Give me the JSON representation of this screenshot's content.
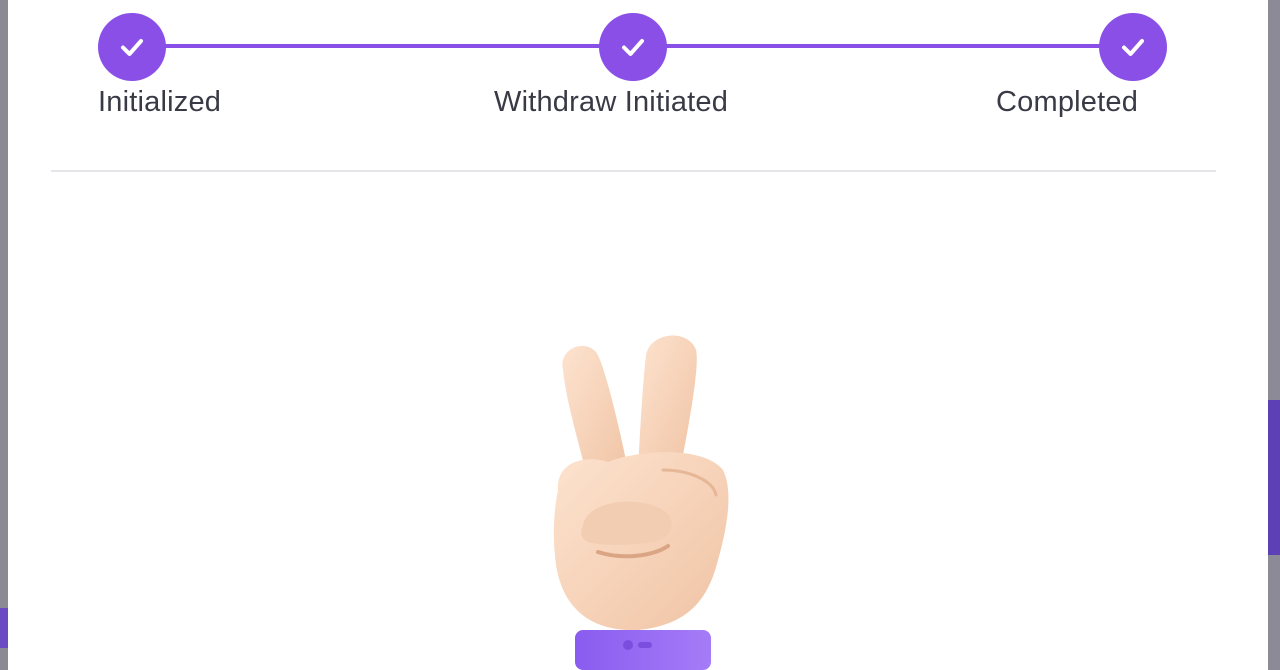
{
  "stepper": {
    "steps": [
      {
        "label": "Initialized",
        "status": "completed"
      },
      {
        "label": "Withdraw Initiated",
        "status": "completed"
      },
      {
        "label": "Completed",
        "status": "completed"
      }
    ]
  },
  "colors": {
    "accent": "#8a4fe6",
    "text": "#3a3a46",
    "divider": "#e6e6ea",
    "background": "#ffffff"
  },
  "icons": {
    "step_icon": "check-icon",
    "illustration": "victory-hand-icon"
  }
}
